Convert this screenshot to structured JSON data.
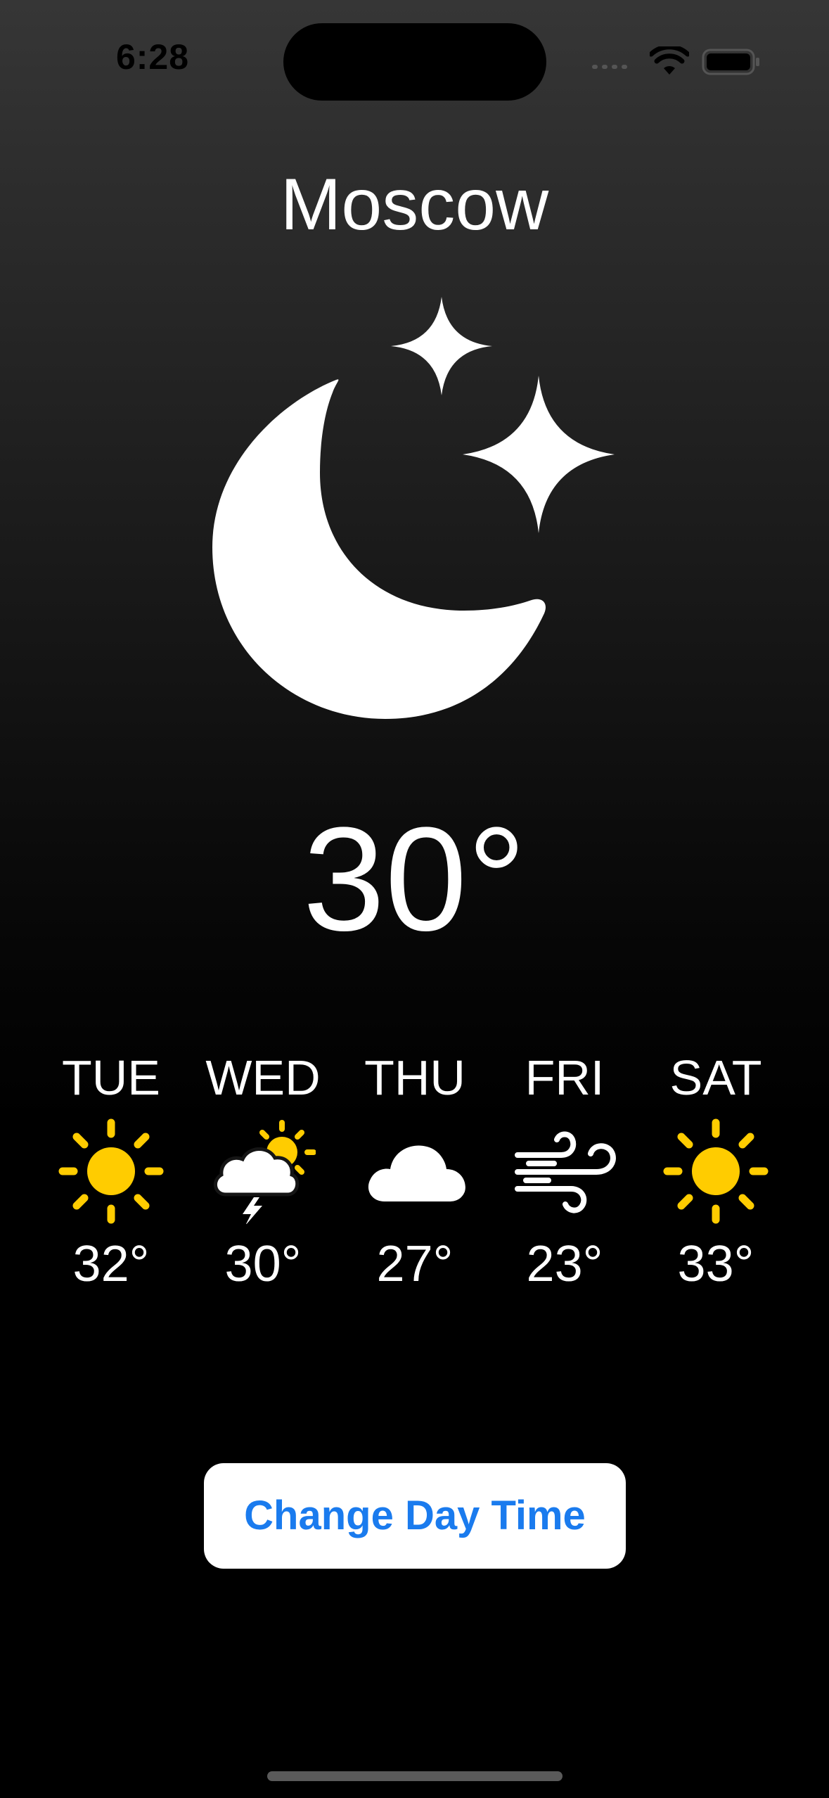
{
  "status_bar": {
    "time": "6:28"
  },
  "city": "Moscow",
  "current": {
    "temperature": "30°",
    "icon": "moon-stars-icon"
  },
  "forecast": [
    {
      "day": "TUE",
      "temp": "32°",
      "icon": "sun-icon"
    },
    {
      "day": "WED",
      "temp": "30°",
      "icon": "thunderstorm-sun-icon"
    },
    {
      "day": "THU",
      "temp": "27°",
      "icon": "cloud-icon"
    },
    {
      "day": "FRI",
      "temp": "23°",
      "icon": "wind-icon"
    },
    {
      "day": "SAT",
      "temp": "33°",
      "icon": "sun-icon"
    }
  ],
  "button": {
    "label": "Change Day Time"
  },
  "colors": {
    "accent": "#1a7bee",
    "sun": "#ffcc00",
    "text": "#ffffff",
    "background_top": "#363636",
    "background_bottom": "#000000"
  }
}
